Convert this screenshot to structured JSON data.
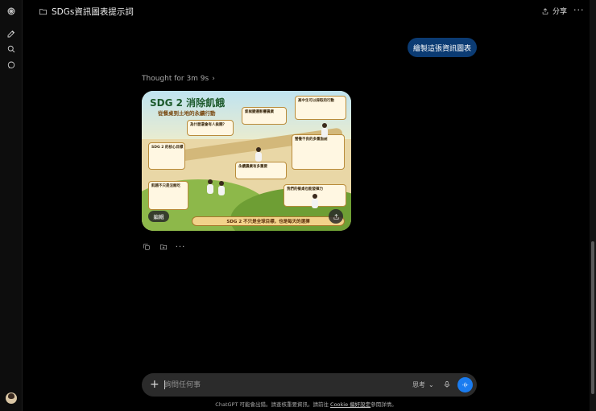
{
  "header": {
    "title": "SDGs資訊圖表提示詞",
    "share_label": "分享",
    "more_label": "···"
  },
  "conversation": {
    "user_message": "繪製這張資訊圖表",
    "thought_label": "Thought for 3m 9s",
    "thought_chevron": "›",
    "image": {
      "title": "SDG 2 消除飢餓",
      "subtitle": "從餐桌到土地的永續行動",
      "panels": [
        "飢餓不只是沒飯吃",
        "SDG 2 的核心目標",
        "為什麼還會有人挨餓？",
        "氣候變遷影響農業",
        "永續農業有多重要",
        "我們的餐桌也能發揮力",
        "高中生可以採取的行動",
        "營養不良的多重面貌"
      ],
      "banner": "SDG 2 不只是全球目標，也是每天的選擇",
      "edit_label": "編輯"
    },
    "actions": {
      "more_label": "···"
    }
  },
  "composer": {
    "plus_label": "+",
    "placeholder": "詢問任何事",
    "mode_label": "思考",
    "mode_chevron": "⌄"
  },
  "footer": {
    "disclaimer_prefix": "ChatGPT 可能會出錯。請查核重要資訊。請前往 ",
    "disclaimer_link": "Cookie 偏好設定",
    "disclaimer_suffix": "參閱詳情。"
  },
  "colors": {
    "user_bubble": "#0b3b73",
    "voice_button": "#1a7cf0",
    "composer_bg": "#2b2b2b"
  },
  "icons": {
    "sidebar": [
      "logo-icon",
      "new-chat-icon",
      "search-icon",
      "chat-bubble-icon"
    ],
    "actions": [
      "copy-icon",
      "save-icon",
      "more-icon"
    ]
  }
}
